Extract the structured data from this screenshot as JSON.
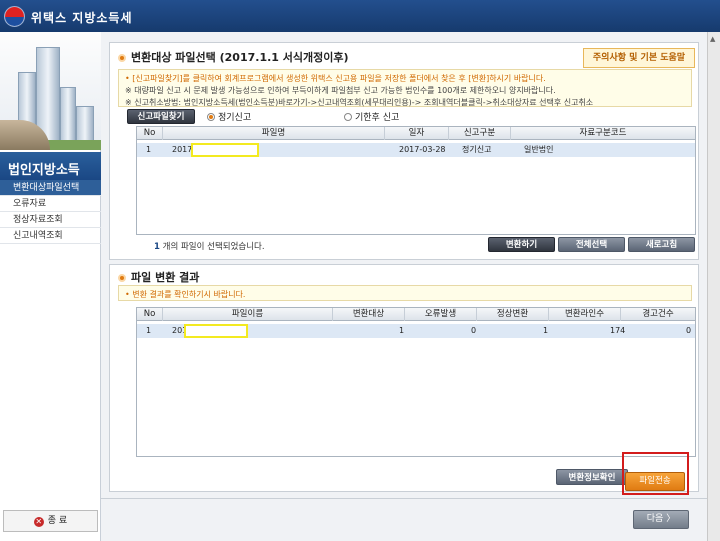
{
  "window": {
    "title": "위택스 지방소득세"
  },
  "sidebar": {
    "title": "법인지방소득",
    "items": [
      {
        "label": "변환대상파일선택",
        "active": true
      },
      {
        "label": "오류자료",
        "active": false
      },
      {
        "label": "정상자료조회",
        "active": false
      },
      {
        "label": "신고내역조회",
        "active": false
      }
    ],
    "exit_label": "종 료"
  },
  "section1": {
    "title": "변환대상 파일선택 (2017.1.1 서식개정이후)",
    "help_button": "주의사항 및 기본 도움말",
    "notes": [
      "• [신고파일찾기]를 클릭하여 회계프로그램에서 생성한 위택스 신고용 파일을 저장한 폴더에서 찾은 후 [변환]하시기 바랍니다.",
      "※ 대량파일 신고 시 문제 발생 가능성으로 인하여 부득이하게 파일첨부 신고 가능한 법인수를 100개로 제한하오니 양지바랍니다.",
      "※ 신고취소방법: 법인지방소득세(법인소득분)바로가기->신고내역조회(세무대리인용)-> 조회내역더블클릭->취소대상자료 선택후 신고취소"
    ],
    "find_button": "신고파일찾기",
    "radio_regular": "정기신고",
    "radio_late": "기한후 신고",
    "table": {
      "headers": [
        "No",
        "파일명",
        "일자",
        "신고구분",
        "자료구분코드"
      ],
      "rows": [
        [
          "1",
          "2017",
          "2017-03-28",
          "정기신고",
          "일반법인"
        ]
      ]
    },
    "count_number": "1",
    "count_text": "개의 파일이 선택되었습니다.",
    "convert_button": "변환하기",
    "select_all_button": "전체선택",
    "refresh_button": "새로고침"
  },
  "section2": {
    "title": "파일 변환 결과",
    "note": "• 변환 결과를 확인하기시 바랍니다.",
    "table": {
      "headers": [
        "No",
        "파일이름",
        "변환대상",
        "오류발생",
        "정상변환",
        "변환라인수",
        "경고건수"
      ],
      "rows": [
        [
          "1",
          "201",
          "1",
          "0",
          "1",
          "174",
          "0"
        ]
      ]
    },
    "info_button": "변환정보확인",
    "send_button": "파일전송"
  },
  "footer": {
    "next_button": "다음 〉"
  }
}
